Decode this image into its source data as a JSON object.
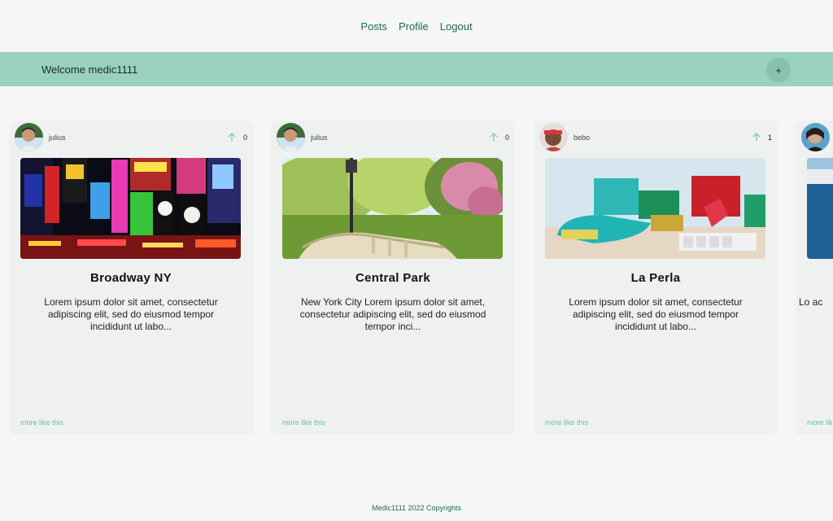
{
  "nav": {
    "items": [
      "Posts",
      "Profile",
      "Logout"
    ]
  },
  "banner": {
    "welcome_text": "Welcome medic1111",
    "add_label": "+"
  },
  "posts": [
    {
      "author": "julius",
      "votes": "0",
      "title": "Broadway NY",
      "excerpt": "Lorem ipsum dolor sit amet, consectetur adipiscing elit, sed do eiusmod tempor incididunt ut labo...",
      "more_label": "more like this",
      "image": "times-square-night-photo"
    },
    {
      "author": "julius",
      "votes": "0",
      "title": "Central Park",
      "excerpt": "New York City Lorem ipsum dolor sit amet, consectetur adipiscing elit, sed do eiusmod tempor inci...",
      "more_label": "more like this",
      "image": "central-park-bridge-photo"
    },
    {
      "author": "bebo",
      "votes": "1",
      "title": "La Perla",
      "excerpt": "Lorem ipsum dolor sit amet, consectetur adipiscing elit, sed do eiusmod tempor incididunt ut labo...",
      "more_label": "more like this",
      "image": "la-perla-colorful-houses-photo"
    },
    {
      "author": "",
      "votes": "",
      "title": "",
      "excerpt": "Lo ac",
      "more_label": "more lik",
      "image": "coastal-city-photo"
    }
  ],
  "footer": {
    "text": "Medic1111 2022 Copyrights"
  },
  "colors": {
    "accent": "#99d1bd",
    "link": "#1f6b4d",
    "more_link": "#6cbfa0",
    "upvote": "#7cc5a8"
  }
}
